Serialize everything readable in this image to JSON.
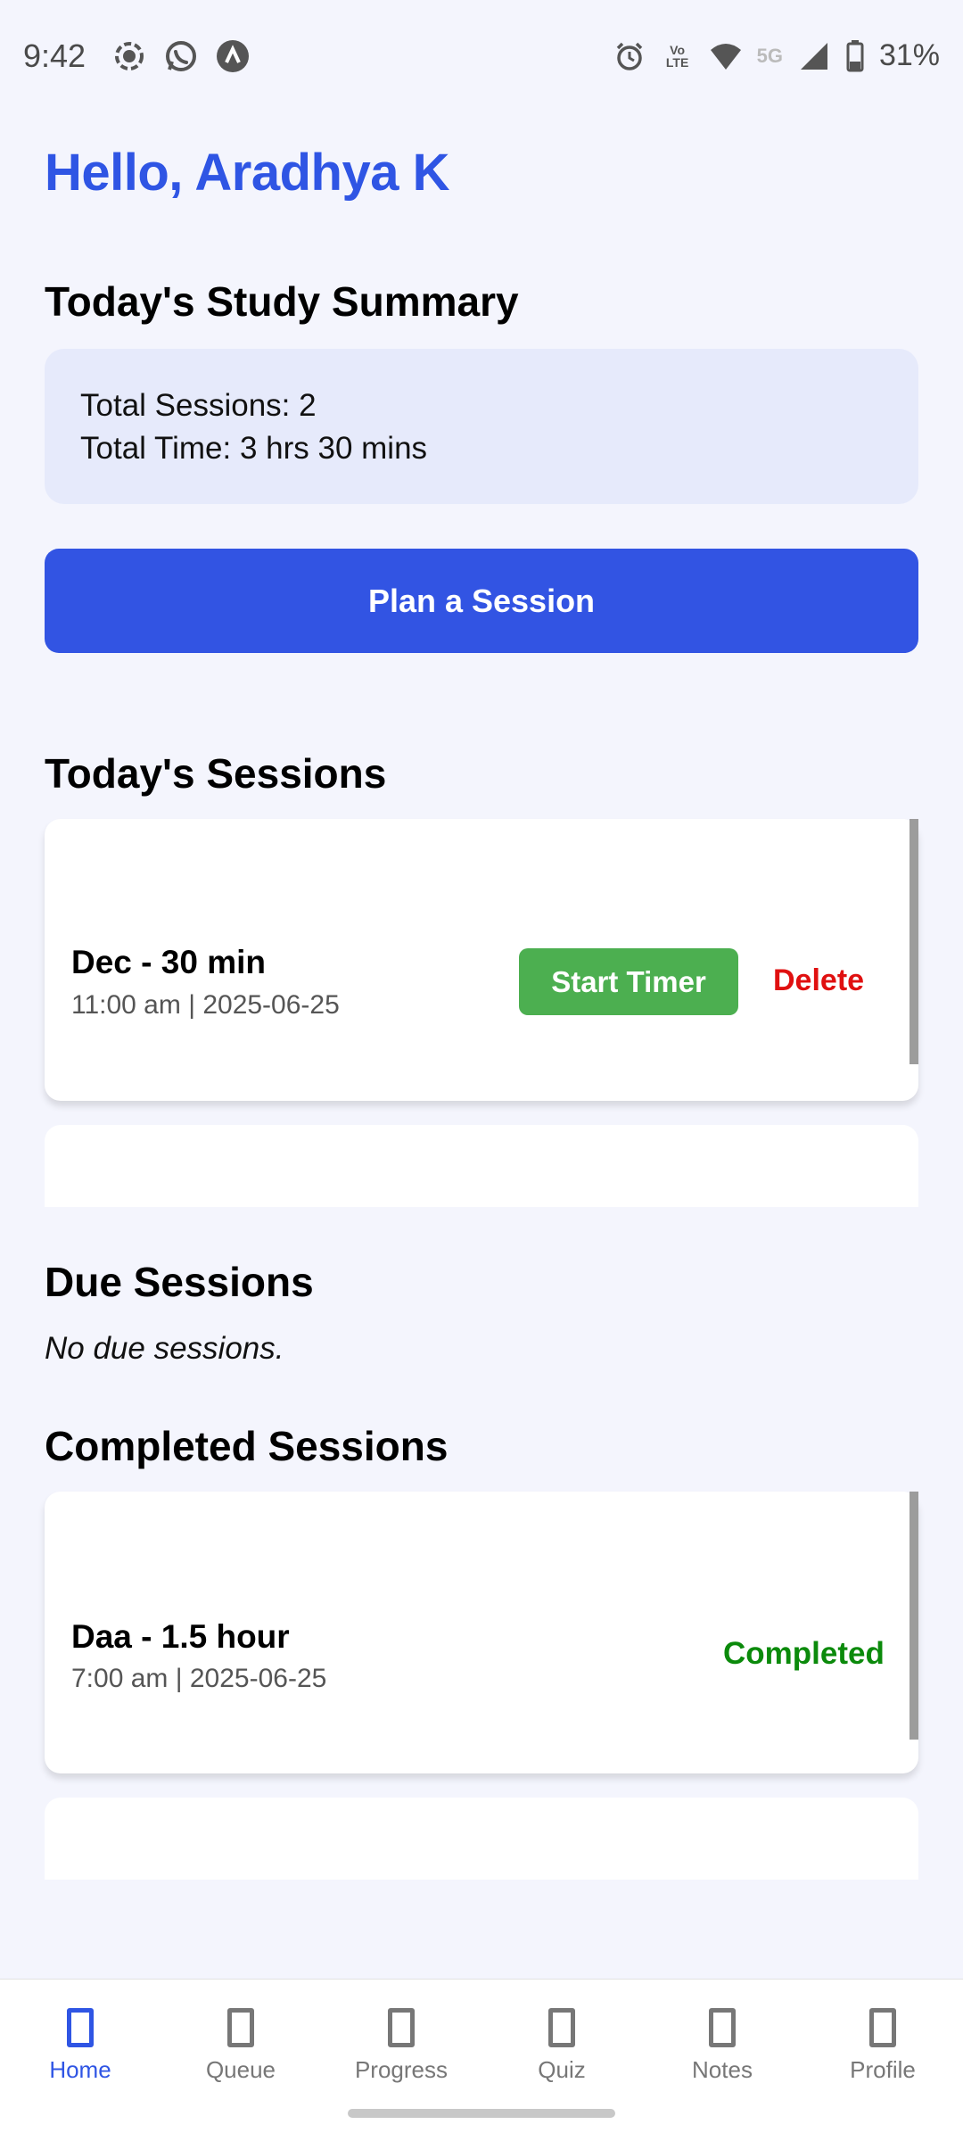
{
  "status_bar": {
    "time": "9:42",
    "battery": "31%",
    "network_label": "5G",
    "volte_label": "Vo LTE",
    "left_icons": [
      "screen-record-icon",
      "whatsapp-icon",
      "app-icon"
    ],
    "right_icons": [
      "alarm-icon",
      "volte-icon",
      "wifi-icon",
      "signal-icon",
      "battery-icon"
    ]
  },
  "greeting": "Hello, Aradhya K",
  "summary": {
    "title": "Today's Study Summary",
    "total_sessions": "Total Sessions: 2",
    "total_time": "Total Time: 3 hrs 30 mins"
  },
  "plan_button": "Plan a Session",
  "todays_sessions": {
    "title": "Today's Sessions",
    "items": [
      {
        "title": "Dec - 30 min",
        "subtitle": "11:00 am | 2025-06-25",
        "start_label": "Start Timer",
        "delete_label": "Delete"
      }
    ]
  },
  "due_sessions": {
    "title": "Due Sessions",
    "empty_text": "No due sessions."
  },
  "completed_sessions": {
    "title": "Completed Sessions",
    "items": [
      {
        "title": "Daa - 1.5 hour",
        "subtitle": "7:00 am | 2025-06-25",
        "status": "Completed"
      }
    ]
  },
  "bottom_nav": {
    "items": [
      {
        "label": "Home",
        "active": true
      },
      {
        "label": "Queue"
      },
      {
        "label": "Progress"
      },
      {
        "label": "Quiz"
      },
      {
        "label": "Notes"
      },
      {
        "label": "Profile"
      }
    ]
  },
  "colors": {
    "accent": "#2f55e4",
    "start_button": "#4caf50",
    "delete": "#e01010",
    "completed": "#0b8a0b",
    "background": "#f4f5fd",
    "summary_card": "#e6eafb"
  }
}
